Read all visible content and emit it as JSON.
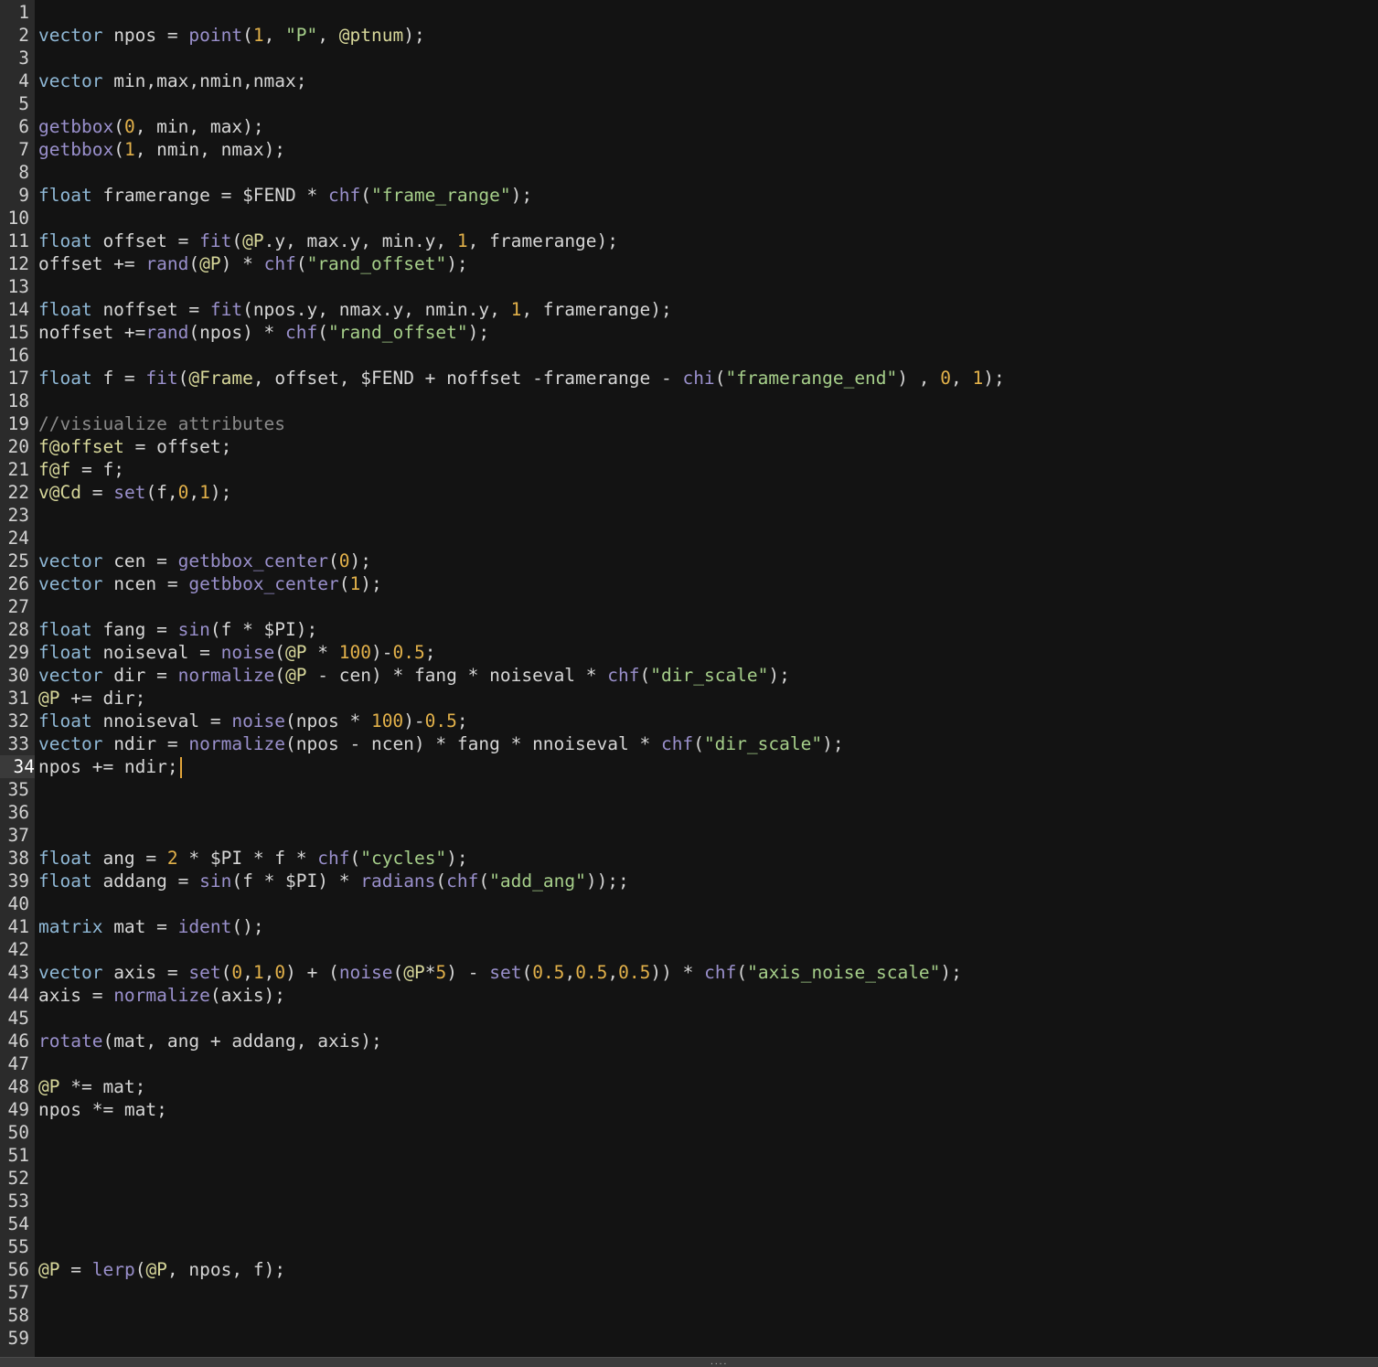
{
  "editor": {
    "current_line": 34,
    "lines": [
      [],
      [
        [
          "kw",
          "vector"
        ],
        [
          "p",
          " npos = "
        ],
        [
          "fn",
          "point"
        ],
        [
          "p",
          "("
        ],
        [
          "num",
          "1"
        ],
        [
          "p",
          ", "
        ],
        [
          "str",
          "\"P\""
        ],
        [
          "p",
          ", "
        ],
        [
          "attr",
          "@ptnum"
        ],
        [
          "p",
          ");"
        ]
      ],
      [],
      [
        [
          "kw",
          "vector"
        ],
        [
          "p",
          " min,max,nmin,nmax;"
        ]
      ],
      [],
      [
        [
          "fn",
          "getbbox"
        ],
        [
          "p",
          "("
        ],
        [
          "num",
          "0"
        ],
        [
          "p",
          ", min, max);"
        ]
      ],
      [
        [
          "fn",
          "getbbox"
        ],
        [
          "p",
          "("
        ],
        [
          "num",
          "1"
        ],
        [
          "p",
          ", nmin, nmax);"
        ]
      ],
      [],
      [
        [
          "kw",
          "float"
        ],
        [
          "p",
          " framerange = $FEND * "
        ],
        [
          "fn",
          "chf"
        ],
        [
          "p",
          "("
        ],
        [
          "str",
          "\"frame_range\""
        ],
        [
          "p",
          ");"
        ]
      ],
      [],
      [
        [
          "kw",
          "float"
        ],
        [
          "p",
          " offset = "
        ],
        [
          "fn",
          "fit"
        ],
        [
          "p",
          "("
        ],
        [
          "attr",
          "@P"
        ],
        [
          "p",
          ".y, max.y, min.y, "
        ],
        [
          "num",
          "1"
        ],
        [
          "p",
          ", framerange);"
        ]
      ],
      [
        [
          "p",
          "offset += "
        ],
        [
          "fn",
          "rand"
        ],
        [
          "p",
          "("
        ],
        [
          "attr",
          "@P"
        ],
        [
          "p",
          ") * "
        ],
        [
          "fn",
          "chf"
        ],
        [
          "p",
          "("
        ],
        [
          "str",
          "\"rand_offset\""
        ],
        [
          "p",
          ");"
        ]
      ],
      [],
      [
        [
          "kw",
          "float"
        ],
        [
          "p",
          " noffset = "
        ],
        [
          "fn",
          "fit"
        ],
        [
          "p",
          "(npos.y, nmax.y, nmin.y, "
        ],
        [
          "num",
          "1"
        ],
        [
          "p",
          ", framerange);"
        ]
      ],
      [
        [
          "p",
          "noffset +="
        ],
        [
          "fn",
          "rand"
        ],
        [
          "p",
          "(npos) * "
        ],
        [
          "fn",
          "chf"
        ],
        [
          "p",
          "("
        ],
        [
          "str",
          "\"rand_offset\""
        ],
        [
          "p",
          ");"
        ]
      ],
      [],
      [
        [
          "kw",
          "float"
        ],
        [
          "p",
          " f = "
        ],
        [
          "fn",
          "fit"
        ],
        [
          "p",
          "("
        ],
        [
          "attr",
          "@Frame"
        ],
        [
          "p",
          ", offset, $FEND + noffset -framerange - "
        ],
        [
          "fn",
          "chi"
        ],
        [
          "p",
          "("
        ],
        [
          "str",
          "\"framerange_end\""
        ],
        [
          "p",
          ") , "
        ],
        [
          "num",
          "0"
        ],
        [
          "p",
          ", "
        ],
        [
          "num",
          "1"
        ],
        [
          "p",
          ");"
        ]
      ],
      [],
      [
        [
          "cm",
          "//visiualize attributes"
        ]
      ],
      [
        [
          "attr",
          "f@offset"
        ],
        [
          "p",
          " = offset;"
        ]
      ],
      [
        [
          "attr",
          "f@f"
        ],
        [
          "p",
          " = f;"
        ]
      ],
      [
        [
          "attr",
          "v@Cd"
        ],
        [
          "p",
          " = "
        ],
        [
          "fn",
          "set"
        ],
        [
          "p",
          "(f,"
        ],
        [
          "num",
          "0"
        ],
        [
          "p",
          ","
        ],
        [
          "num",
          "1"
        ],
        [
          "p",
          ");"
        ]
      ],
      [],
      [],
      [
        [
          "kw",
          "vector"
        ],
        [
          "p",
          " cen = "
        ],
        [
          "fn",
          "getbbox_center"
        ],
        [
          "p",
          "("
        ],
        [
          "num",
          "0"
        ],
        [
          "p",
          ");"
        ]
      ],
      [
        [
          "kw",
          "vector"
        ],
        [
          "p",
          " ncen = "
        ],
        [
          "fn",
          "getbbox_center"
        ],
        [
          "p",
          "("
        ],
        [
          "num",
          "1"
        ],
        [
          "p",
          ");"
        ]
      ],
      [],
      [
        [
          "kw",
          "float"
        ],
        [
          "p",
          " fang = "
        ],
        [
          "fn",
          "sin"
        ],
        [
          "p",
          "(f * $PI);"
        ]
      ],
      [
        [
          "kw",
          "float"
        ],
        [
          "p",
          " noiseval = "
        ],
        [
          "fn",
          "noise"
        ],
        [
          "p",
          "("
        ],
        [
          "attr",
          "@P"
        ],
        [
          "p",
          " * "
        ],
        [
          "num",
          "100"
        ],
        [
          "p",
          ")-"
        ],
        [
          "num",
          "0.5"
        ],
        [
          "p",
          ";"
        ]
      ],
      [
        [
          "kw",
          "vector"
        ],
        [
          "p",
          " dir = "
        ],
        [
          "fn",
          "normalize"
        ],
        [
          "p",
          "("
        ],
        [
          "attr",
          "@P"
        ],
        [
          "p",
          " - cen) * fang * noiseval * "
        ],
        [
          "fn",
          "chf"
        ],
        [
          "p",
          "("
        ],
        [
          "str",
          "\"dir_scale\""
        ],
        [
          "p",
          ");"
        ]
      ],
      [
        [
          "attr",
          "@P"
        ],
        [
          "p",
          " += dir;"
        ]
      ],
      [
        [
          "kw",
          "float"
        ],
        [
          "p",
          " nnoiseval = "
        ],
        [
          "fn",
          "noise"
        ],
        [
          "p",
          "(npos * "
        ],
        [
          "num",
          "100"
        ],
        [
          "p",
          ")-"
        ],
        [
          "num",
          "0.5"
        ],
        [
          "p",
          ";"
        ]
      ],
      [
        [
          "kw",
          "vector"
        ],
        [
          "p",
          " ndir = "
        ],
        [
          "fn",
          "normalize"
        ],
        [
          "p",
          "(npos - ncen) * fang * nnoiseval * "
        ],
        [
          "fn",
          "chf"
        ],
        [
          "p",
          "("
        ],
        [
          "str",
          "\"dir_scale\""
        ],
        [
          "p",
          ");"
        ]
      ],
      [
        [
          "p",
          "npos += ndir;"
        ]
      ],
      [],
      [],
      [],
      [
        [
          "kw",
          "float"
        ],
        [
          "p",
          " ang = "
        ],
        [
          "num",
          "2"
        ],
        [
          "p",
          " * $PI * f * "
        ],
        [
          "fn",
          "chf"
        ],
        [
          "p",
          "("
        ],
        [
          "str",
          "\"cycles\""
        ],
        [
          "p",
          ");"
        ]
      ],
      [
        [
          "kw",
          "float"
        ],
        [
          "p",
          " addang = "
        ],
        [
          "fn",
          "sin"
        ],
        [
          "p",
          "(f * $PI) * "
        ],
        [
          "fn",
          "radians"
        ],
        [
          "p",
          "("
        ],
        [
          "fn",
          "chf"
        ],
        [
          "p",
          "("
        ],
        [
          "str",
          "\"add_ang\""
        ],
        [
          "p",
          "));;"
        ]
      ],
      [],
      [
        [
          "kw",
          "matrix"
        ],
        [
          "p",
          " mat = "
        ],
        [
          "fn",
          "ident"
        ],
        [
          "p",
          "();"
        ]
      ],
      [],
      [
        [
          "kw",
          "vector"
        ],
        [
          "p",
          " axis = "
        ],
        [
          "fn",
          "set"
        ],
        [
          "p",
          "("
        ],
        [
          "num",
          "0"
        ],
        [
          "p",
          ","
        ],
        [
          "num",
          "1"
        ],
        [
          "p",
          ","
        ],
        [
          "num",
          "0"
        ],
        [
          "p",
          ") + ("
        ],
        [
          "fn",
          "noise"
        ],
        [
          "p",
          "("
        ],
        [
          "attr",
          "@P"
        ],
        [
          "p",
          "*"
        ],
        [
          "num",
          "5"
        ],
        [
          "p",
          ") - "
        ],
        [
          "fn",
          "set"
        ],
        [
          "p",
          "("
        ],
        [
          "num",
          "0.5"
        ],
        [
          "p",
          ","
        ],
        [
          "num",
          "0.5"
        ],
        [
          "p",
          ","
        ],
        [
          "num",
          "0.5"
        ],
        [
          "p",
          ")) * "
        ],
        [
          "fn",
          "chf"
        ],
        [
          "p",
          "("
        ],
        [
          "str",
          "\"axis_noise_scale\""
        ],
        [
          "p",
          ");"
        ]
      ],
      [
        [
          "p",
          "axis = "
        ],
        [
          "fn",
          "normalize"
        ],
        [
          "p",
          "(axis);"
        ]
      ],
      [],
      [
        [
          "fn",
          "rotate"
        ],
        [
          "p",
          "(mat, ang + addang, axis);"
        ]
      ],
      [],
      [
        [
          "attr",
          "@P"
        ],
        [
          "p",
          " *= mat;"
        ]
      ],
      [
        [
          "p",
          "npos *= mat;"
        ]
      ],
      [],
      [],
      [],
      [],
      [],
      [],
      [
        [
          "attr",
          "@P"
        ],
        [
          "p",
          " = "
        ],
        [
          "fn",
          "lerp"
        ],
        [
          "p",
          "("
        ],
        [
          "attr",
          "@P"
        ],
        [
          "p",
          ", npos, f);"
        ]
      ],
      [],
      [],
      []
    ]
  },
  "statusbar": {
    "grip_glyph": "....",
    "grip_icon": "resize-grip-icon"
  }
}
